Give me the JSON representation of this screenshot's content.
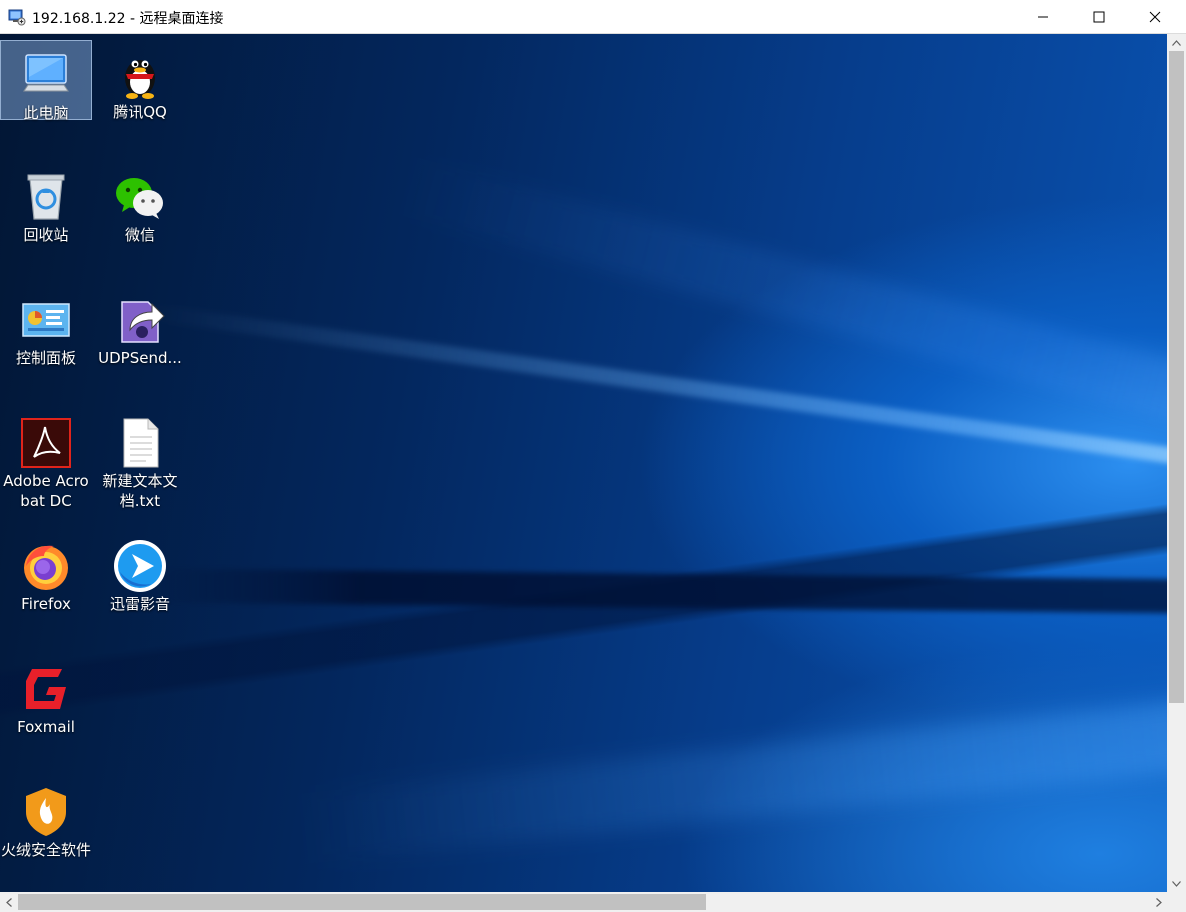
{
  "window": {
    "title": "192.168.1.22 - 远程桌面连接"
  },
  "desktop_icons": [
    {
      "label": "此电脑",
      "icon": "computer-icon"
    },
    {
      "label": "腾讯QQ",
      "icon": "qq-penguin-icon"
    },
    {
      "label": "回收站",
      "icon": "recycle-bin-icon"
    },
    {
      "label": "微信",
      "icon": "wechat-icon"
    },
    {
      "label": "控制面板",
      "icon": "control-panel-icon"
    },
    {
      "label": "UDPSend...",
      "icon": "udpsend-icon"
    },
    {
      "label": "Adobe Acrobat DC",
      "icon": "acrobat-icon"
    },
    {
      "label": "新建文本文档.txt",
      "icon": "text-file-icon"
    },
    {
      "label": "Firefox",
      "icon": "firefox-icon"
    },
    {
      "label": "迅雷影音",
      "icon": "xunlei-player-icon"
    },
    {
      "label": "Foxmail",
      "icon": "foxmail-icon"
    },
    {
      "label": "火绒安全软件",
      "icon": "huorong-security-icon"
    }
  ],
  "colors": {
    "desktop_dark": "#021634",
    "desktop_blue": "#0a55b6",
    "selection": "#96bef0"
  }
}
